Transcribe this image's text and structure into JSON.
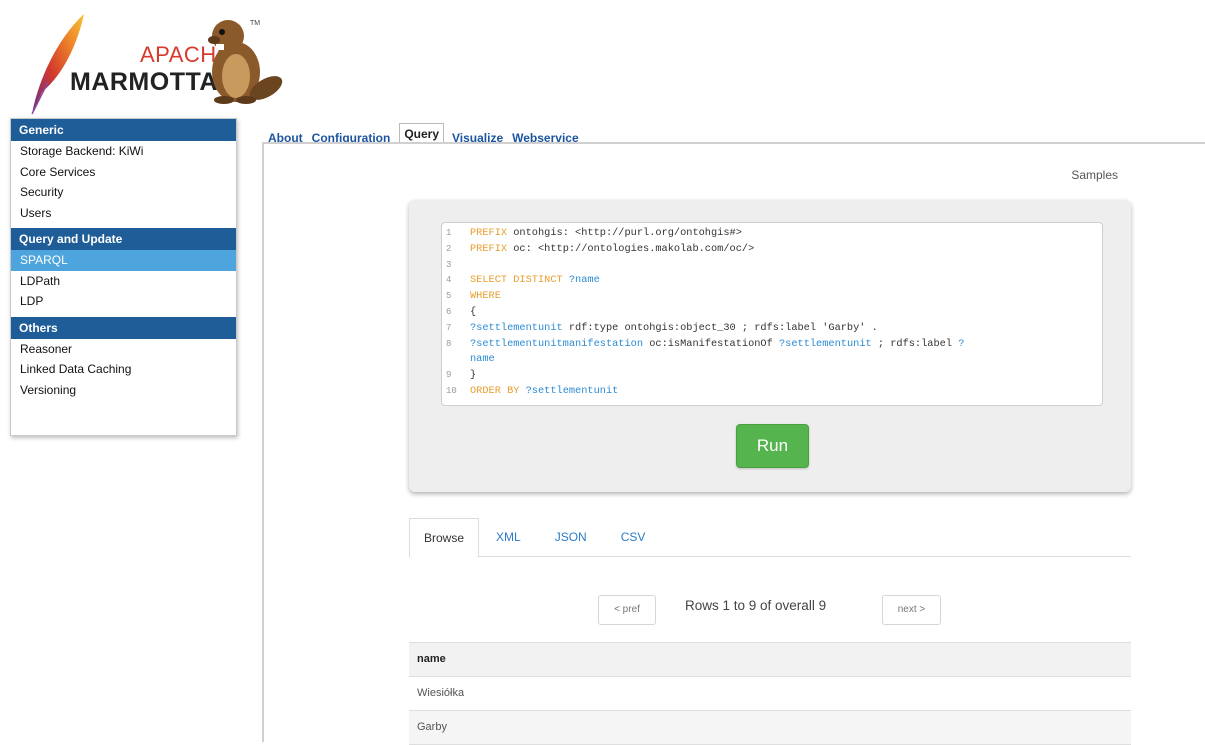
{
  "logo": {
    "line1": "APACHE",
    "line2": "MARMOTTA",
    "tm": "TM"
  },
  "sidebar": {
    "sections": [
      {
        "title": "Generic",
        "items": [
          "Storage Backend: KiWi",
          "Core Services",
          "Security",
          "Users"
        ]
      },
      {
        "title": "Query and Update",
        "items": [
          "SPARQL",
          "LDPath",
          "LDP"
        ]
      },
      {
        "title": "Others",
        "items": [
          "Reasoner",
          "Linked Data Caching",
          "Versioning"
        ]
      }
    ],
    "active_item": "SPARQL"
  },
  "tabs": [
    "About",
    "Configuration",
    "Query",
    "Visualize",
    "Webservice"
  ],
  "active_tab": "Query",
  "samples_link": "Samples",
  "editor": {
    "line_numbers": [
      "1",
      "2",
      "3",
      "4",
      "5",
      "6",
      "7",
      "8",
      "",
      "9",
      "10"
    ],
    "lines": [
      [
        {
          "t": "PREFIX",
          "c": "kw"
        },
        {
          "t": " ontohgis: <http://purl.org/ontohgis#>"
        }
      ],
      [
        {
          "t": "PREFIX",
          "c": "kw"
        },
        {
          "t": " oc: <http://ontologies.makolab.com/oc/>"
        }
      ],
      [],
      [
        {
          "t": "SELECT DISTINCT",
          "c": "kw"
        },
        {
          "t": " "
        },
        {
          "t": "?name",
          "c": "var"
        }
      ],
      [
        {
          "t": "WHERE",
          "c": "kw"
        }
      ],
      [
        {
          "t": "{"
        }
      ],
      [
        {
          "t": "?settlementunit",
          "c": "var"
        },
        {
          "t": " rdf:type ontohgis:object_30 ; rdfs:label 'Garby' ."
        }
      ],
      [
        {
          "t": "?settlementunitmanifestation",
          "c": "var"
        },
        {
          "t": " oc:isManifestationOf "
        },
        {
          "t": "?settlementunit",
          "c": "var"
        },
        {
          "t": " ; rdfs:label "
        },
        {
          "t": "?",
          "c": "var"
        }
      ],
      [
        {
          "t": "name",
          "c": "var"
        }
      ],
      [
        {
          "t": "}"
        }
      ],
      [
        {
          "t": "ORDER BY",
          "c": "kw"
        },
        {
          "t": " "
        },
        {
          "t": "?settlementunit",
          "c": "var"
        }
      ]
    ]
  },
  "run_label": "Run",
  "result_tabs": [
    "Browse",
    "XML",
    "JSON",
    "CSV"
  ],
  "active_result_tab": "Browse",
  "pager": {
    "prev": "< pref",
    "info": "Rows 1 to 9 of overall 9",
    "next": "next >"
  },
  "results": {
    "header": "name",
    "rows": [
      "Wiesiółka",
      "Garby"
    ]
  },
  "colors": {
    "header_blue": "#1f5d98",
    "active_blue": "#4ea4dc",
    "run_green": "#56b44e",
    "keyword": "#e89e2c",
    "variable": "#2a8ad4"
  }
}
